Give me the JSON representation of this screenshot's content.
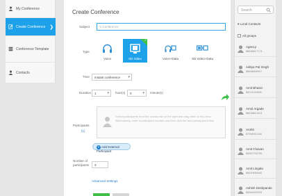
{
  "nav": {
    "items": [
      {
        "label": "My Conference"
      },
      {
        "label": "Create Conference",
        "arrow": "❯"
      },
      {
        "label": "Conference Template"
      },
      {
        "label": "Contacts"
      }
    ]
  },
  "form": {
    "title": "Create Conference",
    "subject_label": "Subject",
    "subject_value": "'s Conference",
    "type_label": "Type",
    "types": [
      {
        "label": "Voice",
        "icon": "headset-icon",
        "selected": false
      },
      {
        "label": "SD Video",
        "icon": "video-screen-icon",
        "selected": true
      },
      {
        "label": "Voice+Data",
        "icon": "voice-data-icon",
        "selected": false
      },
      {
        "label": "SD Video+Data",
        "icon": "video-data-icon",
        "selected": false
      }
    ],
    "time_label": "Time",
    "time_value": "Instant conference",
    "duration_label": "Duration",
    "duration_hours": "1",
    "hours_label": "hour(s)",
    "duration_minutes": "0",
    "minutes_label": "minute(s)",
    "participants_label": "Participants",
    "participants_count": "(1)",
    "participants_hint": "Select participants from the contact list on the right and drag them to this area. Alternatively, enter a participant number and then click the add participant button.",
    "add_external_label": "Add External Participant",
    "num_participants_label": "Number of participants",
    "num_participants_value": "3",
    "advanced_label": "Advanced Settings"
  },
  "contacts": {
    "search_placeholder": "Search",
    "section_label": "Local Contacts",
    "group_label": "All groups",
    "list": [
      {
        "name": "Agency",
        "number": "88638617173"
      },
      {
        "name": "Aditya Pal Singh",
        "number": "88638659907"
      },
      {
        "name": "Amit Bhasin",
        "number": "88711123825"
      },
      {
        "name": "Amol Argade",
        "number": "88638612413"
      },
      {
        "name": "Arohit",
        "number": "87256911440"
      },
      {
        "name": "Amit Chavan",
        "number": "88387232750"
      },
      {
        "name": "Amit Lingala",
        "number": "88440553440"
      },
      {
        "name": "Ashish Deshpande",
        "number": "88384002019"
      }
    ]
  },
  "colors": {
    "accent": "#1da1e8",
    "success": "#3fbf4a"
  }
}
